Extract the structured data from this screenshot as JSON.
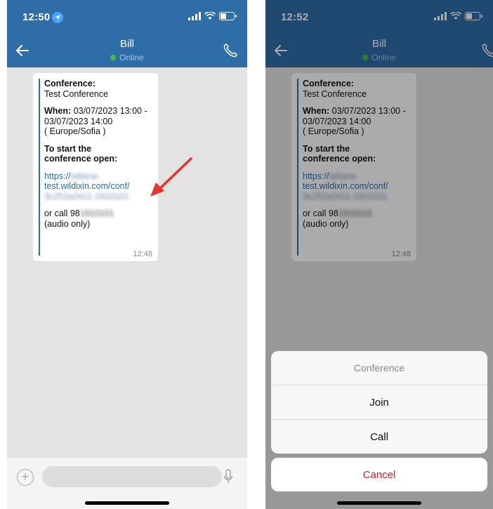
{
  "left": {
    "status": {
      "time": "12:50"
    },
    "header": {
      "contact_name": "Bill",
      "presence": "Online"
    },
    "message": {
      "conference_label": "Conference:",
      "conference_name": "Test Conference",
      "when_label": "When:",
      "when_line1": " 03/07/2023 13:00 -",
      "when_line2": "03/07/2023 14:00",
      "when_tz": "( Europe/Sofia )",
      "start_label_line1": "To start the",
      "start_label_line2": "conference open:",
      "link_prefix": "https://",
      "link_hidden_1": "tatiana-",
      "link_line2": "test.wildixin.com/conf/",
      "link_hidden_2": "3c252a2411-1910101",
      "call_prefix": "or call 98",
      "call_hidden": "1910101",
      "audio_only": "(audio only)",
      "time": "12:48"
    }
  },
  "right": {
    "status": {
      "time": "12:52"
    },
    "header": {
      "contact_name": "Bill",
      "presence": "Online"
    },
    "message": {
      "conference_label": "Conference:",
      "conference_name": "Test Conference",
      "when_label": "When:",
      "when_line1": " 03/07/2023 13:00 -",
      "when_line2": "03/07/2023 14:00",
      "when_tz": "( Europe/Sofia )",
      "start_label_line1": "To start the",
      "start_label_line2": "conference open:",
      "link_prefix": "https://",
      "link_hidden_1": "tatiana-",
      "link_line2": "test.wildixin.com/conf/",
      "link_hidden_2": "3c252a2411-1910101",
      "call_prefix": "or call 98",
      "call_hidden": "1910101",
      "audio_only": "(audio only)",
      "time": "12:48"
    },
    "action_sheet": {
      "title": "Conference",
      "options": [
        "Join",
        "Call"
      ],
      "cancel": "Cancel"
    }
  },
  "colors": {
    "header_blue": "#2f6da8",
    "online_green": "#3cc23c",
    "cancel_red": "#e02020",
    "annotation_red": "#e8332a"
  },
  "icons": {
    "back": "arrow-left-icon",
    "call": "phone-icon",
    "add": "plus-icon",
    "mic": "microphone-icon",
    "location": "location-arrow-icon"
  }
}
